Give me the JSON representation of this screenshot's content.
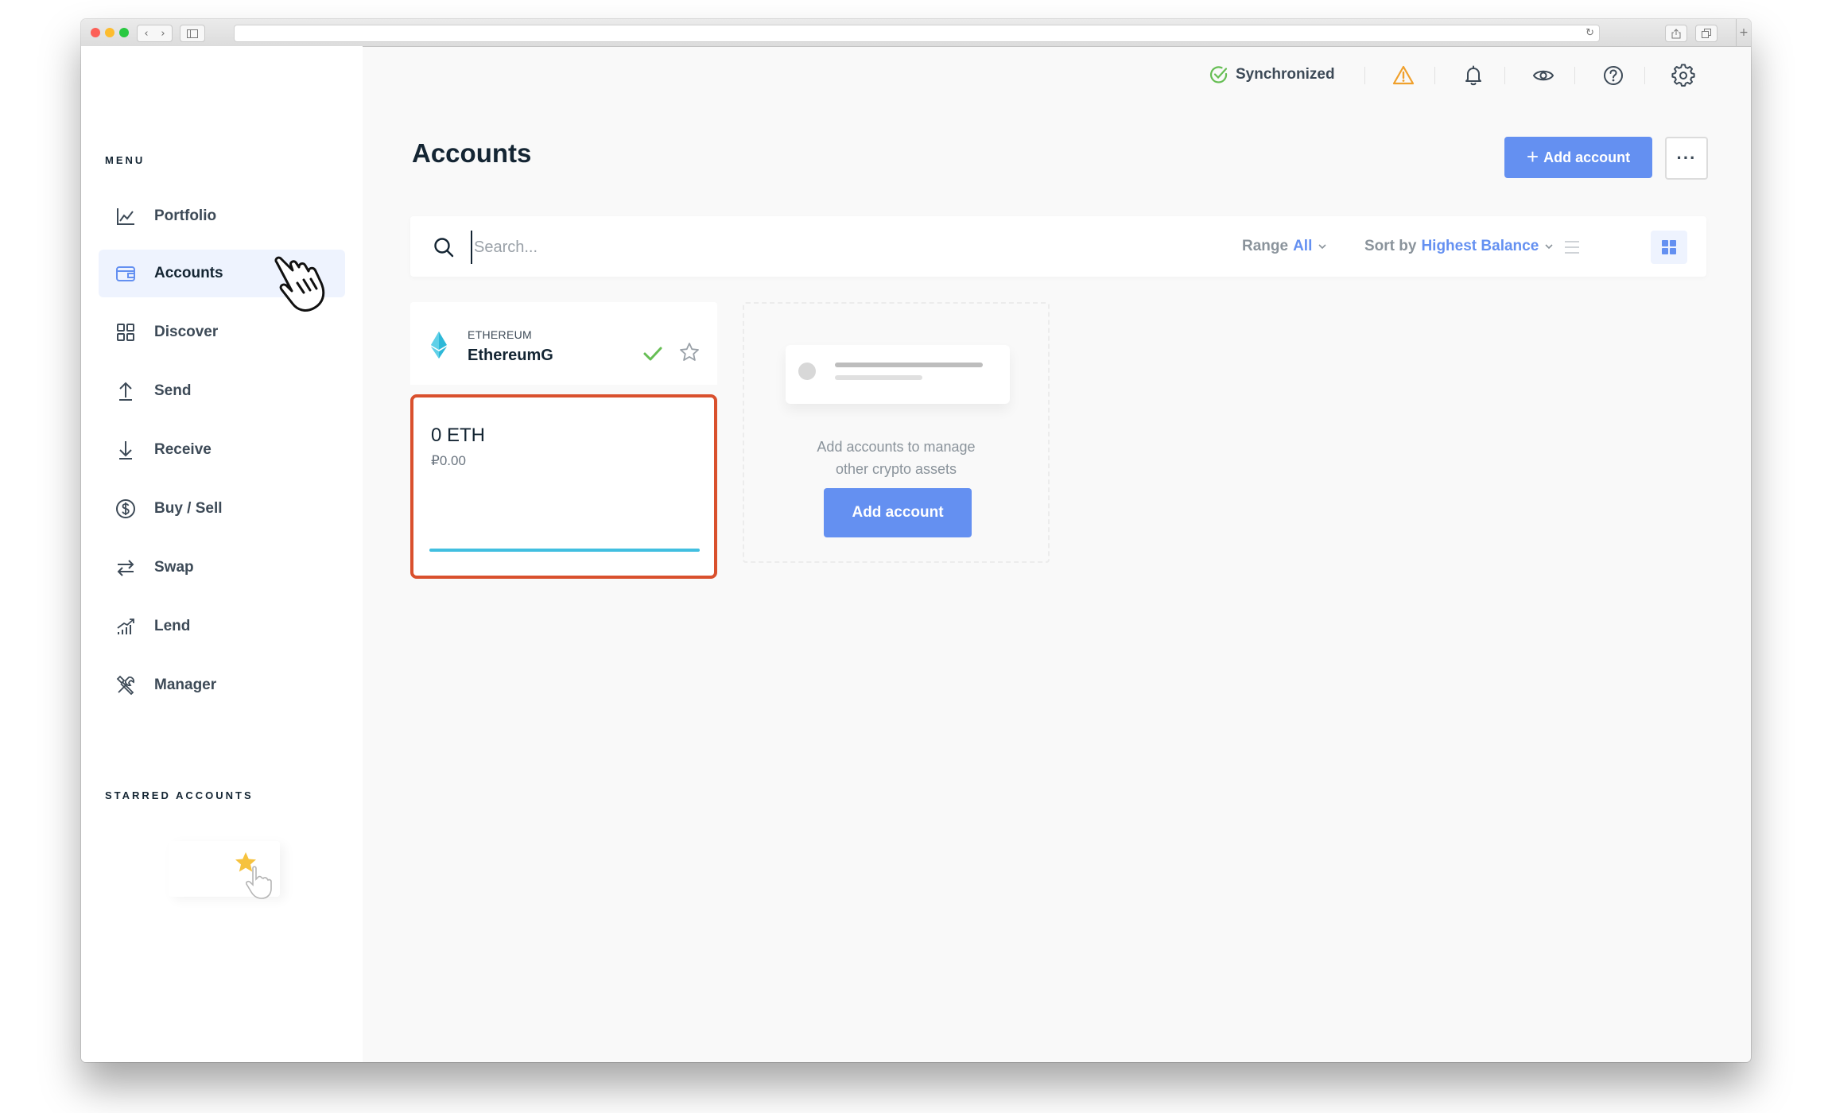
{
  "browser": {
    "back_glyph": "‹",
    "forward_glyph": "›",
    "reload_glyph": "↻",
    "new_tab_glyph": "+"
  },
  "sidebar": {
    "menu_label": "MENU",
    "items": [
      {
        "label": "Portfolio",
        "icon": "chart-line-icon"
      },
      {
        "label": "Accounts",
        "icon": "wallet-icon",
        "active": true
      },
      {
        "label": "Discover",
        "icon": "grid-icon"
      },
      {
        "label": "Send",
        "icon": "arrow-up-icon"
      },
      {
        "label": "Receive",
        "icon": "arrow-down-icon"
      },
      {
        "label": "Buy / Sell",
        "icon": "dollar-circle-icon"
      },
      {
        "label": "Swap",
        "icon": "swap-icon"
      },
      {
        "label": "Lend",
        "icon": "lend-chart-icon"
      },
      {
        "label": "Manager",
        "icon": "tools-icon"
      }
    ],
    "starred_label": "STARRED ACCOUNTS"
  },
  "topbar": {
    "sync_label": "Synchronized",
    "icons": [
      "warning-icon",
      "bell-icon",
      "eye-icon",
      "help-icon",
      "settings-icon"
    ]
  },
  "main": {
    "title": "Accounts",
    "add_account_label": "Add account",
    "add_account_plus": "+",
    "more_label": "···",
    "search_placeholder": "Search...",
    "range_label": "Range",
    "range_value": "All",
    "sort_label": "Sort by",
    "sort_value": "Highest Balance"
  },
  "account_card": {
    "currency": "ETHEREUM",
    "name": "EthereumG",
    "balance": "0 ETH",
    "fiat": "₽0.00"
  },
  "placeholder_card": {
    "text_line1": "Add accounts to manage",
    "text_line2": "other crypto assets",
    "button_label": "Add account"
  },
  "colors": {
    "accent": "#6490f1",
    "sync_green": "#66be54",
    "warning": "#f0a02c",
    "highlight_border": "#d9502d",
    "sparkline": "#41bfe0",
    "eth_logo": "#2db8d8"
  }
}
